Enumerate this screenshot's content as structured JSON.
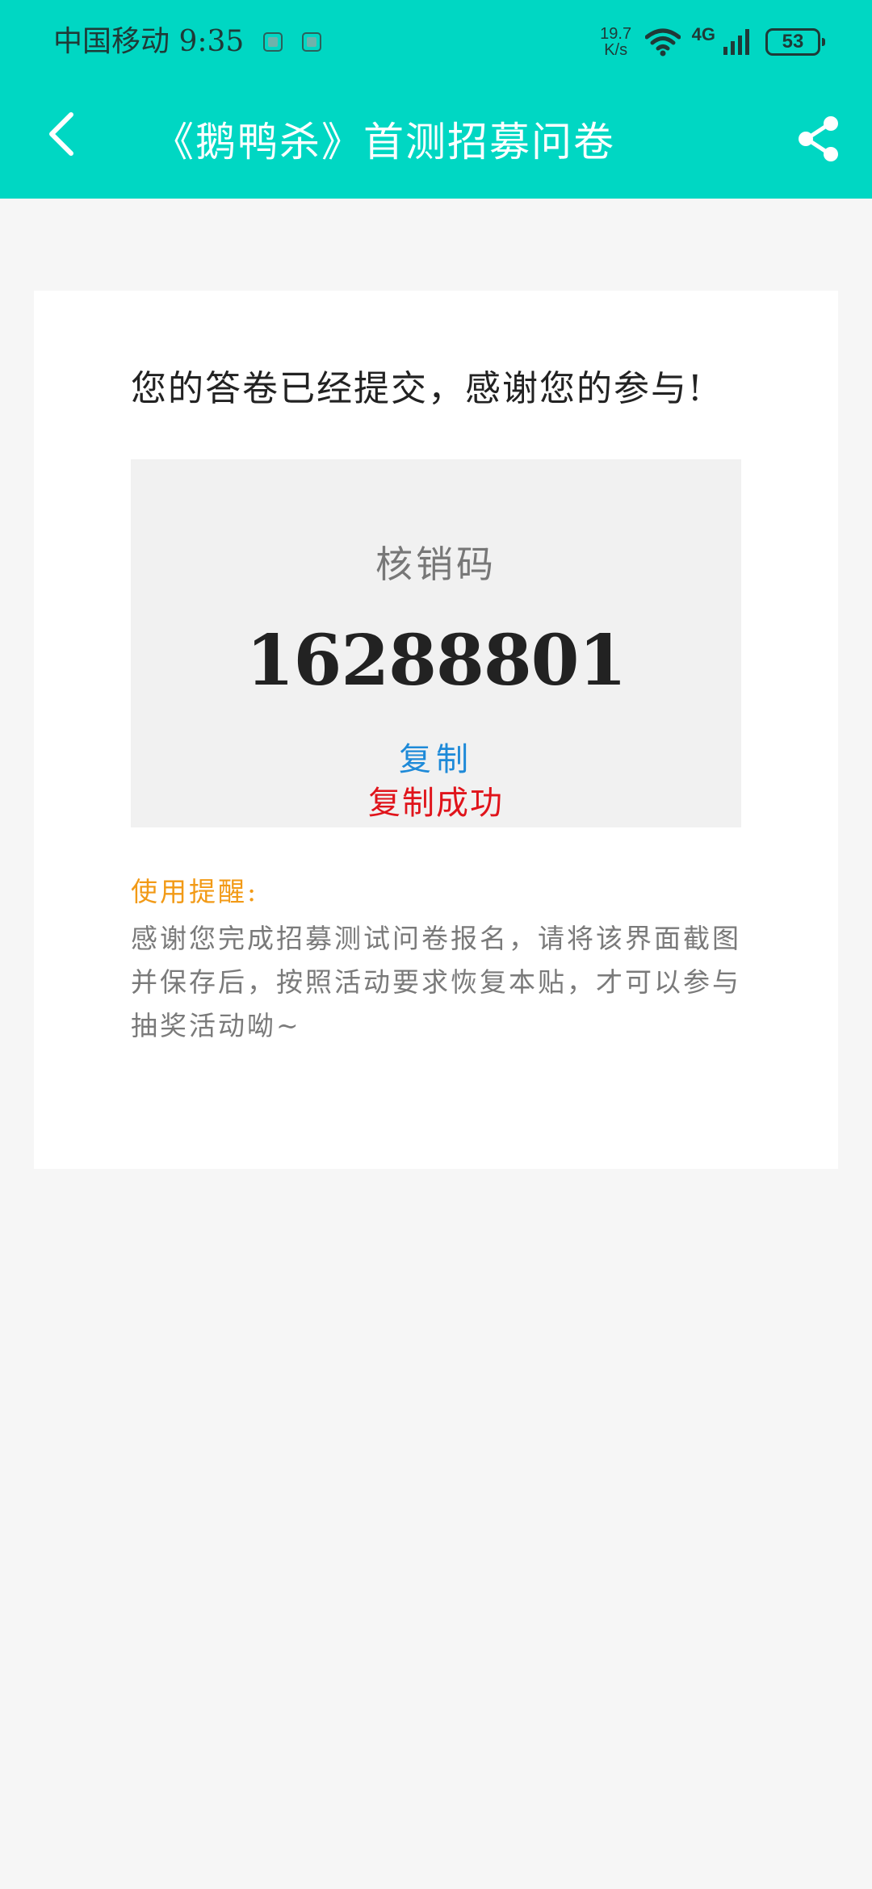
{
  "status_bar": {
    "carrier_time": "中国移动 9:35",
    "net_speed": "19.7",
    "net_speed_unit": "K/s",
    "network_type": "4G",
    "battery": "53"
  },
  "app_bar": {
    "title": "《鹅鸭杀》首测招募问卷"
  },
  "result": {
    "message": "您的答卷已经提交，感谢您的参与!",
    "code_label": "核销码",
    "code_value": "16288801",
    "copy_label": "复制",
    "copy_success": "复制成功"
  },
  "tips": {
    "title": "使用提醒:",
    "body": "感谢您完成招募测试问卷报名，请将该界面截图并保存后，按照活动要求恢复本贴，才可以参与抽奖活动呦~"
  },
  "colors": {
    "header": "#00d7c3",
    "background": "#f6f6f6",
    "copy": "#1e8ad8",
    "success": "#e0141b",
    "tip_title": "#f29a16"
  }
}
